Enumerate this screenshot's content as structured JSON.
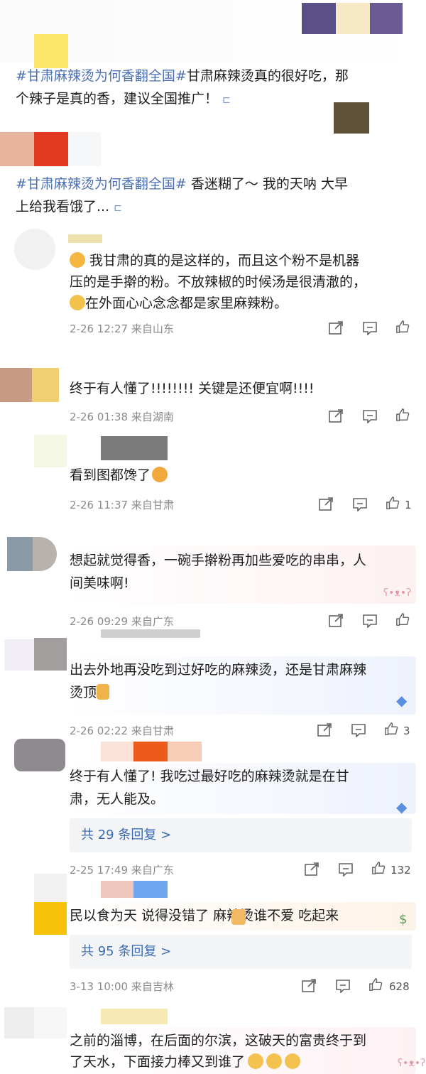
{
  "post1": {
    "tag": "#甘肃麻辣烫为何香翻全国#",
    "line1_rest": "甘肃麻辣烫真的很好吃，那",
    "line2": "个辣子是真的香，建议全国推广！"
  },
  "post2": {
    "tag": "#甘肃麻辣烫为何香翻全国#",
    "line1_rest": " 香迷糊了～ 我的天呐 大早",
    "line2": "上给我看饿了..."
  },
  "comments": [
    {
      "line1": "我甘肃的真的是这样的，而且这个粉不是机器",
      "line2": "压的是手擀的粉。不放辣椒的时候汤是很清澈的，",
      "line3": "在外面心心念念都是家里麻辣粉。",
      "time": "2-26 12:27",
      "location": "来自山东",
      "likes": ""
    },
    {
      "line1": "终于有人懂了!!!!!!!!  关键是还便宜啊!!!!",
      "time": "2-26 01:38",
      "location": "来自湖南",
      "likes": ""
    },
    {
      "line1": "看到图都馋了",
      "time": "2-26 11:37",
      "location": "来自甘肃",
      "likes": "1"
    },
    {
      "line1": "想起就觉得香，一碗手擀粉再加些爱吃的串串，人",
      "line2": "间美味啊!",
      "time": "2-26 09:29",
      "location": "来自广东",
      "likes": ""
    },
    {
      "line1": "出去外地再没吃到过好吃的麻辣烫，还是甘肃麻辣",
      "line2": "烫顶",
      "time": "2-26 02:22",
      "location": "来自甘肃",
      "likes": "3"
    },
    {
      "line1": "终于有人懂了! 我吃过最好吃的麻辣烫就是在甘",
      "line2": "肃，无人能及。",
      "reply": "共 29 条回复 >",
      "time": "2-25 17:49",
      "location": "来自广东",
      "likes": "132"
    },
    {
      "line1": "民以食为天 说得没错了      麻辣烫谁不爱 吃起来",
      "reply": "共 95 条回复 >",
      "time": "3-13 10:00",
      "location": "来自吉林",
      "likes": "628"
    },
    {
      "line1": "之前的淄博，在后面的尔滨，这破天的富贵终于到",
      "line2": "了天水，下面接力棒又到谁了"
    }
  ],
  "colors": {
    "hashtag": "#4b6fb3",
    "link": "#3c6bb5",
    "meta": "#8a8a8a"
  }
}
